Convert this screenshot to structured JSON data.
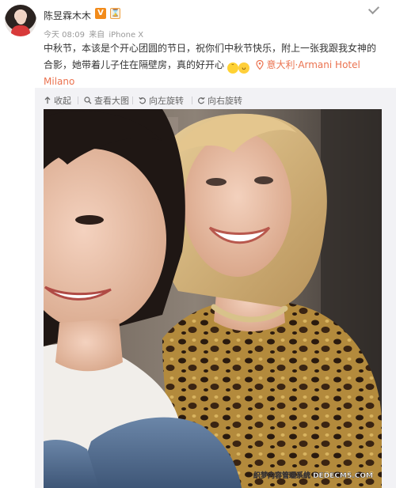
{
  "post": {
    "author": "陈昱霖木木",
    "vip_badge": "V",
    "level_badge": "⌛",
    "time": "今天 08:09",
    "source_prefix": "来自",
    "device": "iPhone X",
    "text_line1": "中秋节，本该是个开心团圆的节日，祝你们中秋节快乐，附上一张我跟我女神的",
    "text_line2": "合影，她带着儿子住在隔壁房，真的好开心",
    "location": "意大利·Armani Hotel",
    "location_line2": "Milano"
  },
  "toolbar": {
    "collapse": "收起",
    "view_large": "查看大图",
    "rotate_left": "向左旋转",
    "rotate_right": "向右旋转"
  },
  "icons": {
    "more": "chevron-down-icon",
    "collapse": "arrow-up-icon",
    "view_large": "magnifier-icon",
    "rotate_left": "rotate-left-icon",
    "rotate_right": "rotate-right-icon",
    "location": "location-pin-icon"
  },
  "watermark": "织梦内容管理系统 DEDECMS.COM",
  "colors": {
    "accent": "#eb7350",
    "vip": "#f28b1a",
    "toolbar_bg": "#f2f2f5"
  }
}
